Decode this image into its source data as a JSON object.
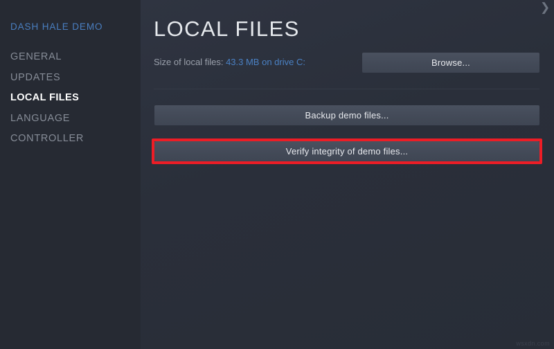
{
  "sidebar": {
    "title": "DASH HALE DEMO",
    "items": [
      {
        "label": "GENERAL",
        "active": false
      },
      {
        "label": "UPDATES",
        "active": false
      },
      {
        "label": "LOCAL FILES",
        "active": true
      },
      {
        "label": "LANGUAGE",
        "active": false
      },
      {
        "label": "CONTROLLER",
        "active": false
      }
    ]
  },
  "main": {
    "page_title": "LOCAL FILES",
    "size_label": "Size of local files:",
    "size_value": "43.3 MB on drive C:",
    "browse_label": "Browse...",
    "backup_label": "Backup demo files...",
    "verify_label": "Verify integrity of demo files..."
  },
  "overlay": {
    "highlight_color": "#ed1d26",
    "top_right_glyph": "❯",
    "watermark": "wsxdn.com"
  },
  "colors": {
    "sidebar_bg": "#262a33",
    "main_bg": "#2a2f3a",
    "accent_blue": "#4a7fc1",
    "button_bg": "#464d5b",
    "active_text": "#ffffff",
    "inactive_text": "#878d98"
  }
}
